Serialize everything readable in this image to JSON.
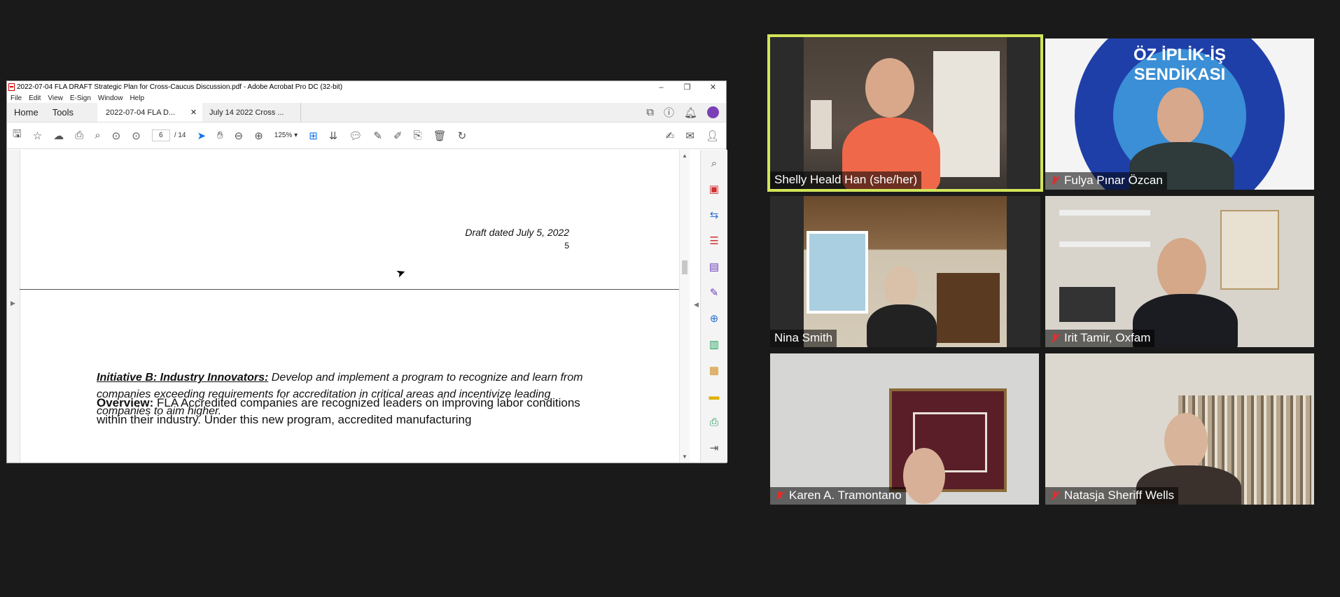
{
  "acrobat": {
    "window_title": "2022-07-04 FLA DRAFT Strategic Plan for Cross-Caucus Discussion.pdf - Adobe Acrobat Pro DC (32-bit)",
    "menu": [
      "File",
      "Edit",
      "View",
      "E-Sign",
      "Window",
      "Help"
    ],
    "tabs": {
      "home": "Home",
      "tools": "Tools",
      "doc1": "2022-07-04 FLA D...",
      "doc2": "July 14 2022 Cross ..."
    },
    "toolbar": {
      "current_page": "6",
      "total_pages": "/ 14",
      "zoom": "125%"
    },
    "document": {
      "draft_label": "Draft dated July 5, 2022",
      "page_number": "5",
      "initiative_lead": "Initiative B: Industry Innovators:",
      "initiative_text": " Develop and implement a program to recognize and learn from companies exceeding requirements for accreditation in critical areas and incentivize leading companies to aim higher.",
      "overview_lead": "Overview:",
      "overview_text": " FLA Accredited companies are recognized leaders on improving labor conditions within their industry. Under this new program, accredited manufacturing"
    }
  },
  "participants": [
    {
      "name": "Shelly Heald Han (she/her)",
      "muted": false,
      "speaking": true
    },
    {
      "name": "Fulya Pınar Özcan",
      "muted": true,
      "speaking": false
    },
    {
      "name": "Nina Smith",
      "muted": false,
      "speaking": false
    },
    {
      "name": "Irit Tamir, Oxfam",
      "muted": true,
      "speaking": false
    },
    {
      "name": "Karen A. Tramontano",
      "muted": true,
      "speaking": false
    },
    {
      "name": "Natasja Sheriff Wells",
      "muted": true,
      "speaking": false
    }
  ],
  "logo_text": "ÖZ İPLİK-İŞ SENDİKASI",
  "colors": {
    "active_speaker_border": "#d2e55a",
    "mute_red": "#e02f2f",
    "background": "#1a1a1a"
  }
}
